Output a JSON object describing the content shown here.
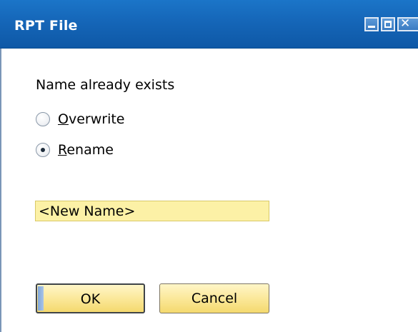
{
  "window": {
    "title": "RPT File",
    "controls": {
      "minimize_icon": "minimize-icon",
      "maximize_icon": "maximize-icon",
      "close_icon": "close-icon"
    }
  },
  "dialog": {
    "message": "Name already exists",
    "options": [
      {
        "label_accel": "O",
        "label_rest": "verwrite",
        "selected": false
      },
      {
        "label_accel": "R",
        "label_rest": "ename",
        "selected": true
      }
    ],
    "new_name_value": "<New Name>",
    "buttons": {
      "ok_label": "OK",
      "cancel_label": "Cancel"
    }
  },
  "colors": {
    "titlebar": "#1566b8",
    "input_background": "#fcf1a6",
    "button_background": "#fbe89a"
  }
}
